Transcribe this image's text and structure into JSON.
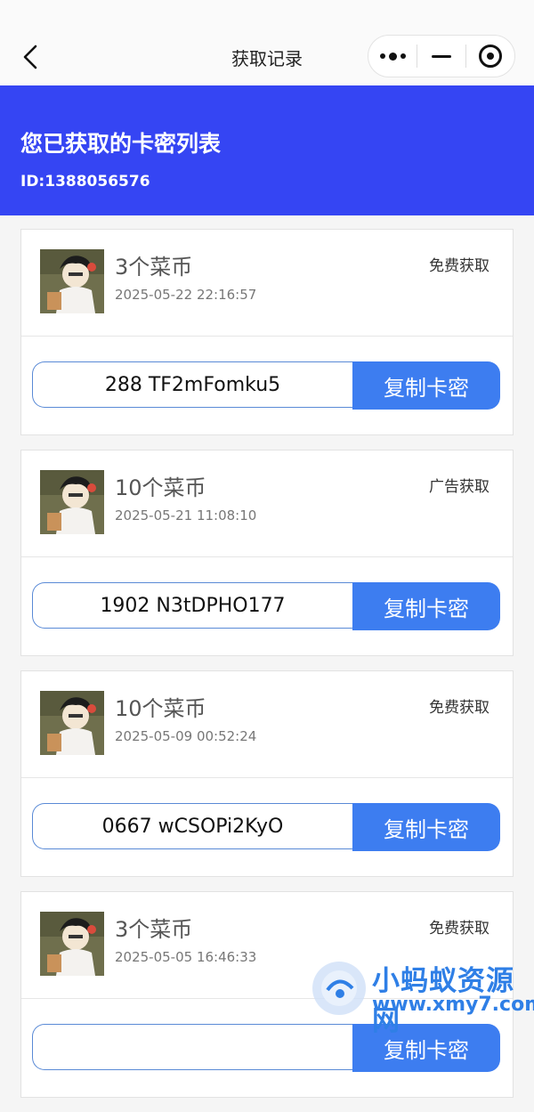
{
  "nav": {
    "title": "获取记录",
    "back_icon": "chevron-left-icon",
    "more_icon": "more-dots-icon",
    "minimize_icon": "minimize-icon",
    "close_icon": "target-close-icon"
  },
  "banner": {
    "title": "您已获取的卡密列表",
    "user_id": "ID:1388056576",
    "color": "#3545f3"
  },
  "copy_label": "复制卡密",
  "cards": [
    {
      "coins": "3个菜币",
      "time": "2025-05-22 22:16:57",
      "source": "免费获取",
      "code": "288 TF2mFomku5"
    },
    {
      "coins": "10个菜币",
      "time": "2025-05-21 11:08:10",
      "source": "广告获取",
      "code": "1902 N3tDPHO177"
    },
    {
      "coins": "10个菜币",
      "time": "2025-05-09 00:52:24",
      "source": "免费获取",
      "code": "0667 wCSOPi2KyO"
    },
    {
      "coins": "3个菜币",
      "time": "2025-05-05 16:46:33",
      "source": "免费获取",
      "code": ""
    }
  ],
  "watermark": {
    "text": "小蚂蚁资源网",
    "url": "www.xmy7.com"
  },
  "colors": {
    "accent": "#3d7df0",
    "banner": "#3545f3"
  }
}
